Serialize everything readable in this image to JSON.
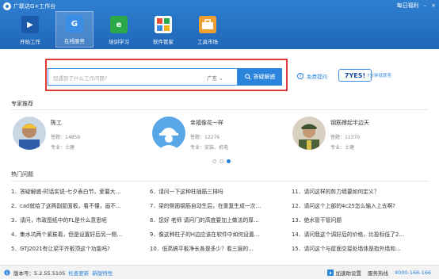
{
  "window": {
    "title": "广联达G+工作台",
    "sign_in": "每日福利",
    "minimize": "–",
    "close": "×"
  },
  "nav": [
    {
      "label": "开始工作",
      "icon": "start-icon",
      "color": "#1b5aa8"
    },
    {
      "label": "在线服务",
      "icon": "online-service-icon",
      "color": "#3a8ee6",
      "active": true
    },
    {
      "label": "培训学习",
      "icon": "training-icon",
      "color": "#2aa84a"
    },
    {
      "label": "软件管家",
      "icon": "software-manager-icon",
      "color": "#e9a21c"
    },
    {
      "label": "工具市场",
      "icon": "tool-market-icon",
      "color": "#f0a030"
    }
  ],
  "search": {
    "placeholder": "您遇到了什么工作问题?",
    "region": "广东",
    "button": "答疑解惑",
    "help": "免费提问",
    "badge_main": "7YES!",
    "badge_sub": "7分钟就获答"
  },
  "experts_title": "专家推荐",
  "experts": [
    {
      "name": "陈工",
      "answers": "答题：14859",
      "specialty": "专业：土建"
    },
    {
      "name": "幸福像花一样",
      "answers": "答题：12276",
      "specialty": "专业：安装、机电"
    },
    {
      "name": "钢筋撑起半边天",
      "answers": "答题：11370",
      "specialty": "专业：土建"
    }
  ],
  "questions_title": "热门问题",
  "questions": [
    "1．答疑解惑-时话实说-七夕表白节，爱要大…",
    "6．请问一下这种柱插筋三排吗",
    "11．请问这样的剪力墙要如何定义？",
    "2．cad就给了这两副屋面板，看不懂，画不…",
    "7．梁的侧面钢筋自动生后，在重复生成一次…",
    "12．请问这个上部的4c25怎么输入上去啊?",
    "3．请问，市政图纸中的FL是什么意思呢",
    "8．您好 老师 请问门的高度要加上做法的厚…",
    "13．绝水管干管问题",
    "4．集水坑两个紧挨着，但是设置好后另一侧…",
    "9．像这种柱子的H边应该在软件中如何设置…",
    "14．请问我这个调好后的价格，比投标低了2…",
    "5．GTJ2021有让梁平齐板顶这个功能吗?",
    "10．低高搞平板净长各是多少？看三层的…",
    "15．请问这个与屋面交接处墙体是指外墙和…"
  ],
  "footer": {
    "version": "版本号：5.2.55.5105",
    "check_update": "检查更新",
    "new_features": "新版特性",
    "speed_settings": "加速助设置",
    "hotline": "服务热线",
    "phone": "4000-166-166"
  }
}
